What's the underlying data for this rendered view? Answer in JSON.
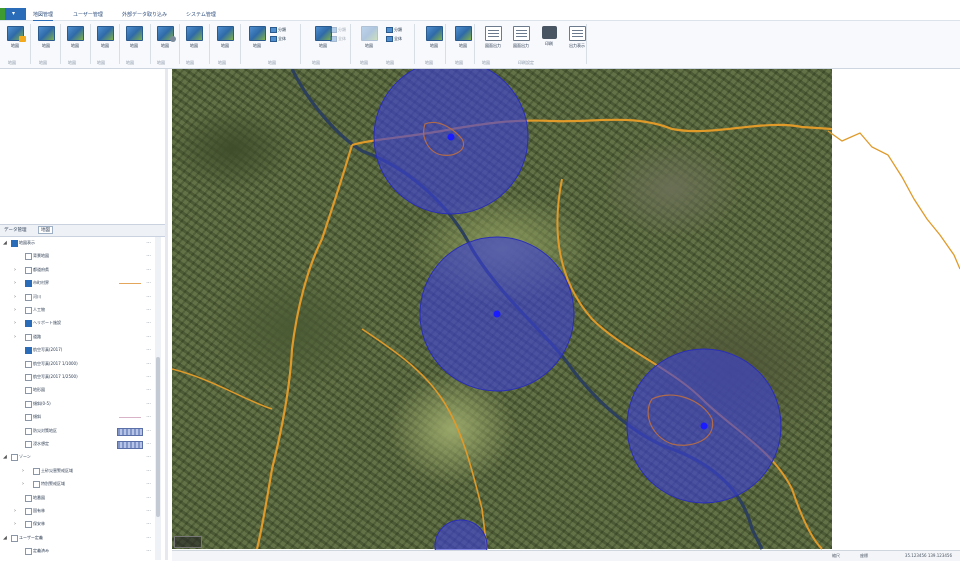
{
  "tabs": [
    {
      "label": "地図管理",
      "active": true
    },
    {
      "label": "ユーザー管理",
      "active": false
    },
    {
      "label": "外部データ取り込み",
      "active": false
    },
    {
      "label": "システム管理",
      "active": false
    }
  ],
  "ribbon": {
    "buttons": [
      {
        "label": "地図"
      },
      {
        "label": "地図"
      },
      {
        "label": "地図"
      },
      {
        "label": "地図"
      },
      {
        "label": "地図"
      },
      {
        "label": "地図"
      },
      {
        "label": "地図"
      },
      {
        "label": "地図"
      },
      {
        "label": "地図"
      },
      {
        "label": "地図"
      },
      {
        "label": "地図"
      },
      {
        "label": "地図"
      },
      {
        "label": "地図"
      },
      {
        "label": "地図"
      },
      {
        "label": "地図"
      }
    ],
    "small_pairs": [
      {
        "a": "分類",
        "b": "全体"
      },
      {
        "a": "分類",
        "b": "全体"
      },
      {
        "a": "分類",
        "b": "全体"
      }
    ],
    "doc_buttons": [
      {
        "label": "図面出力"
      },
      {
        "label": "図面出力"
      },
      {
        "label": "印刷"
      },
      {
        "label": "出力表示"
      }
    ],
    "group_labels": [
      "地図",
      "地図",
      "地図",
      "地図",
      "地図",
      "地図",
      "地図",
      "地図",
      "地図",
      "地図",
      "地図",
      "地図",
      "地図",
      "地図",
      "地図",
      "印刷設定"
    ]
  },
  "layer_panel": {
    "tabs": [
      {
        "label": "データ管理"
      },
      {
        "label": "地図"
      }
    ],
    "rows": [
      {
        "text": "地図表示",
        "level": 0,
        "checked": true,
        "expand": "◢"
      },
      {
        "text": "背景地図",
        "level": 1,
        "checked": false,
        "expand": ""
      },
      {
        "text": "都道府県",
        "level": 1,
        "checked": false,
        "expand": "›"
      },
      {
        "text": "市町村界",
        "level": 1,
        "checked": true,
        "expand": "›",
        "swatch": "line"
      },
      {
        "text": "河川",
        "level": 1,
        "checked": false,
        "expand": "›"
      },
      {
        "text": "人工物",
        "level": 1,
        "checked": false,
        "expand": "›"
      },
      {
        "text": "ヘリポート施設",
        "level": 1,
        "checked": true,
        "expand": "›"
      },
      {
        "text": "道路",
        "level": 1,
        "checked": false,
        "expand": "›"
      },
      {
        "text": "航空写真(2017)",
        "level": 1,
        "checked": true,
        "expand": ""
      },
      {
        "text": "航空写真(2017 1/1000)",
        "level": 1,
        "checked": false,
        "expand": ""
      },
      {
        "text": "航空写真(2017 1/2500)",
        "level": 1,
        "checked": false,
        "expand": ""
      },
      {
        "text": "地形図",
        "level": 1,
        "checked": false,
        "expand": ""
      },
      {
        "text": "傾斜(0-5)",
        "level": 1,
        "checked": false,
        "expand": ""
      },
      {
        "text": "傾斜",
        "level": 1,
        "checked": false,
        "expand": "",
        "swatch": "pink"
      },
      {
        "text": "防災対策地区",
        "level": 1,
        "checked": false,
        "expand": "",
        "swatch": "grid"
      },
      {
        "text": "浸水想定",
        "level": 1,
        "checked": false,
        "expand": "",
        "swatch": "grid"
      },
      {
        "text": "ゾーン",
        "level": 0,
        "checked": false,
        "expand": "◢"
      },
      {
        "text": "土砂災害警戒区域",
        "level": 2,
        "checked": false,
        "expand": "›"
      },
      {
        "text": "特別警戒区域",
        "level": 2,
        "checked": false,
        "expand": "›"
      },
      {
        "text": "地番図",
        "level": 1,
        "checked": false,
        "expand": ""
      },
      {
        "text": "国有林",
        "level": 1,
        "checked": false,
        "expand": "›"
      },
      {
        "text": "保安林",
        "level": 1,
        "checked": false,
        "expand": "›"
      },
      {
        "text": "ユーザー定義",
        "level": 0,
        "checked": false,
        "expand": "◢"
      },
      {
        "text": "定義済み",
        "level": 1,
        "checked": false,
        "expand": ""
      }
    ]
  },
  "map": {
    "circle_color": "#3b3fd6",
    "boundary_color": "#e09a2a",
    "river_color": "#2c3f5c",
    "circle_count": 4
  },
  "statusbar": {
    "scale": "縮尺",
    "coord_label": "座標",
    "coords": "35.123456  139.123456"
  }
}
